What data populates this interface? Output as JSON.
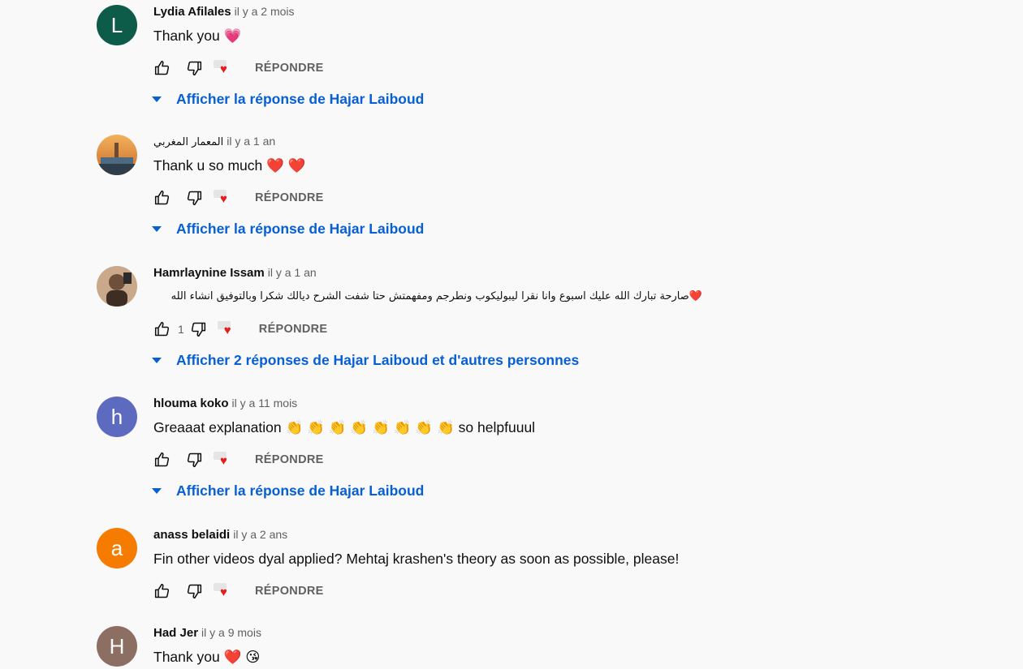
{
  "labels": {
    "reply": "RÉPONDRE"
  },
  "colors": {
    "link_blue": "#065fd4",
    "meta_gray": "#606060",
    "heart_red": "#e41e1e"
  },
  "comments": [
    {
      "author": "Lydia Afilales",
      "time": "il y a 2 mois",
      "text": "Thank you 💗",
      "avatar_letter": "L",
      "avatar_color": "#0d5c4a",
      "likes": "",
      "replies": "Afficher la réponse de Hajar Laiboud"
    },
    {
      "author": "المعمار المغربي",
      "time": "il y a 1 an",
      "text": "Thank u so much ❤️ ❤️",
      "avatar_letter": "",
      "avatar_color": "",
      "likes": "",
      "replies": "Afficher la réponse de Hajar Laiboud"
    },
    {
      "author": "Hamrlaynine Issam",
      "time": "il y a 1 an",
      "text": "❤️صارحة تبارك الله عليك اسبوع وانا نقرا ليبوليكوب ونطرجم ومفهمتش حتا شفت الشرح ديالك شكرا وبالتوفيق انشاء الله",
      "avatar_letter": "",
      "avatar_color": "",
      "likes": "1",
      "replies": "Afficher 2 réponses de Hajar Laiboud et d'autres personnes"
    },
    {
      "author": "hlouma koko",
      "time": "il y a 11 mois",
      "text": "Greaaat explanation 👏 👏 👏 👏 👏 👏 👏 👏 so helpfuuul",
      "avatar_letter": "h",
      "avatar_color": "#5c6bc0",
      "likes": "",
      "replies": "Afficher la réponse de Hajar Laiboud"
    },
    {
      "author": "anass belaidi",
      "time": "il y a 2 ans",
      "text": "Fin other videos dyal applied? Mehtaj krashen's theory as soon as possible, please!",
      "avatar_letter": "a",
      "avatar_color": "#f57c00",
      "likes": "",
      "replies": ""
    },
    {
      "author": "Had Jer",
      "time": "il y a 9 mois",
      "text": "Thank you ❤️ 😘",
      "avatar_letter": "H",
      "avatar_color": "#8d6e63",
      "likes": "",
      "replies": ""
    }
  ]
}
